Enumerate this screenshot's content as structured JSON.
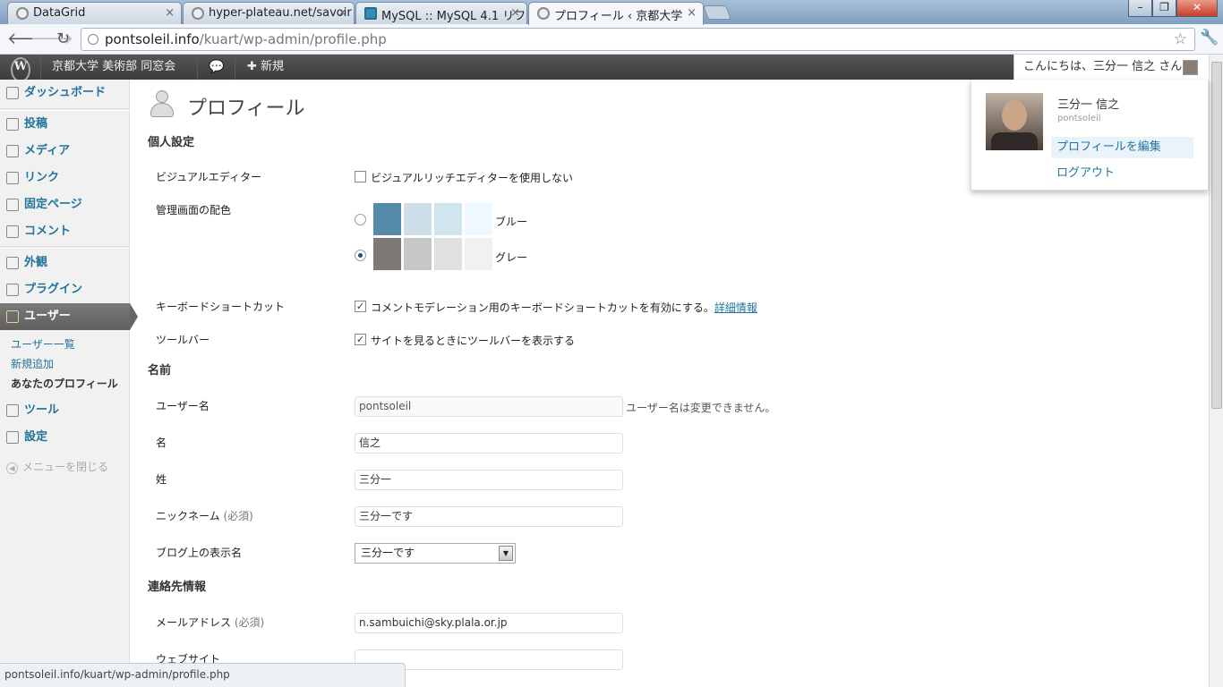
{
  "browser": {
    "tabs": [
      {
        "title": "DataGrid",
        "icon": "globe-icon"
      },
      {
        "title": "hyper-plateau.net/savoir",
        "icon": "globe-icon"
      },
      {
        "title": "MySQL :: MySQL 4.1 リフ",
        "icon": "mysql-icon"
      },
      {
        "title": "プロフィール ‹ 京都大学",
        "icon": "globe-icon"
      }
    ],
    "url_host": "pontsoleil.info",
    "url_path": "/kuart/wp-admin/profile.php",
    "status_url": "pontsoleil.info/kuart/wp-admin/profile.php",
    "window_controls": [
      "–",
      "❐",
      "✕"
    ]
  },
  "adminbar": {
    "site_name": "京都大学 美術部 同窓会",
    "new_label": "新規",
    "howdy": "こんにちは、三分一 信之 さん！"
  },
  "sidebar": {
    "items": [
      {
        "label": "ダッシュボード",
        "icon": "dashboard-icon"
      },
      {
        "label": "投稿",
        "icon": "pin-icon"
      },
      {
        "label": "メディア",
        "icon": "media-icon"
      },
      {
        "label": "リンク",
        "icon": "link-icon"
      },
      {
        "label": "固定ページ",
        "icon": "page-icon"
      },
      {
        "label": "コメント",
        "icon": "comment-icon"
      },
      {
        "label": "外観",
        "icon": "appearance-icon"
      },
      {
        "label": "プラグイン",
        "icon": "plugin-icon"
      },
      {
        "label": "ユーザー",
        "icon": "users-icon"
      },
      {
        "label": "ツール",
        "icon": "tools-icon"
      },
      {
        "label": "設定",
        "icon": "settings-icon"
      }
    ],
    "users_submenu": [
      "ユーザー一覧",
      "新規追加",
      "あなたのプロフィール"
    ],
    "collapse_label": "メニューを閉じる"
  },
  "main": {
    "page_title": "プロフィール",
    "section_personal": "個人設定",
    "visual_editor_label": "ビジュアルエディター",
    "visual_editor_option": "ビジュアルリッチエディターを使用しない",
    "visual_editor_checked": false,
    "color_scheme_label": "管理画面の配色",
    "schemes": [
      {
        "name": "ブルー",
        "colors": [
          "#5589aa",
          "#cfdfe9",
          "#d1e5ee",
          "#eff8ff"
        ],
        "selected": false
      },
      {
        "name": "グレー",
        "colors": [
          "#7c7976",
          "#c6c6c6",
          "#e0e0e0",
          "#f1f1f1"
        ],
        "selected": true
      }
    ],
    "shortcuts_label": "キーボードショートカット",
    "shortcuts_option": "コメントモデレーション用のキーボードショートカットを有効にする。",
    "shortcuts_link": "詳細情報",
    "shortcuts_checked": true,
    "toolbar_label": "ツールバー",
    "toolbar_option": "サイトを見るときにツールバーを表示する",
    "toolbar_checked": true,
    "section_name": "名前",
    "username_label": "ユーザー名",
    "username_value": "pontsoleil",
    "username_desc": "ユーザー名は変更できません。",
    "first_name_label": "名",
    "first_name_value": "信之",
    "last_name_label": "姓",
    "last_name_value": "三分一",
    "nickname_label": "ニックネーム",
    "required": "(必須)",
    "nickname_value": "三分一です",
    "display_name_label": "ブログ上の表示名",
    "display_name_value": "三分一です",
    "section_contact": "連絡先情報",
    "email_label": "メールアドレス",
    "email_value": "n.sambuichi@sky.plala.or.jp",
    "website_label": "ウェブサイト",
    "website_value": ""
  },
  "popup": {
    "name": "三分一 信之",
    "login": "pontsoleil",
    "edit_profile": "プロフィールを編集",
    "logout": "ログアウト"
  }
}
